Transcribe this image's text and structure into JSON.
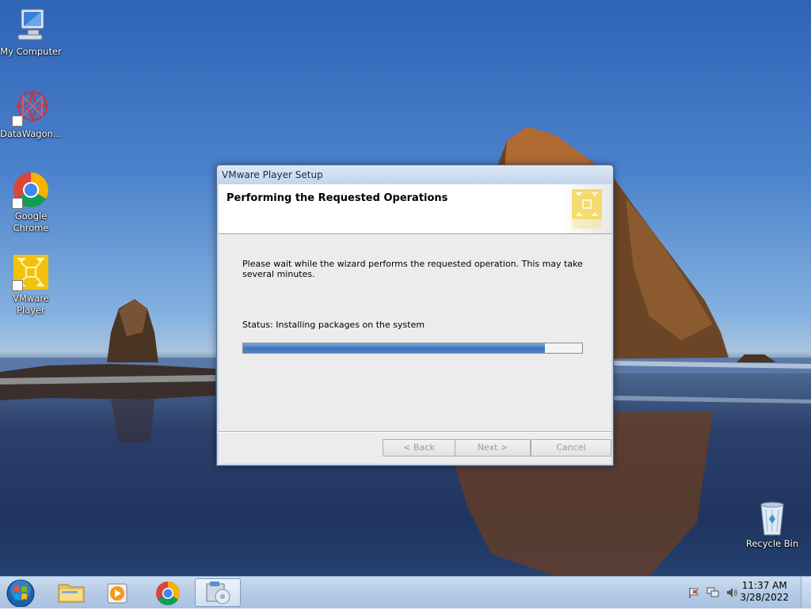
{
  "desktop": {
    "icons": [
      {
        "label": "My Computer"
      },
      {
        "label": "DataWagon..."
      },
      {
        "label": "Google\nChrome"
      },
      {
        "label": "VMware\nPlayer"
      },
      {
        "label": "Recycle Bin"
      }
    ]
  },
  "dialog": {
    "title": "VMware Player Setup",
    "heading": "Performing the Requested Operations",
    "body": "Please wait while the wizard performs the requested operation. This may take several minutes.",
    "status": "Status: Installing packages on the system",
    "progress_fraction": 0.89,
    "buttons": {
      "back": "< Back",
      "next": "Next >",
      "cancel": "Cancel"
    }
  },
  "taskbar": {
    "time": "11:37 AM",
    "date": "3/28/2022"
  },
  "colors": {
    "progress": "#3f73b8",
    "taskbar": "#b5cbe5"
  }
}
